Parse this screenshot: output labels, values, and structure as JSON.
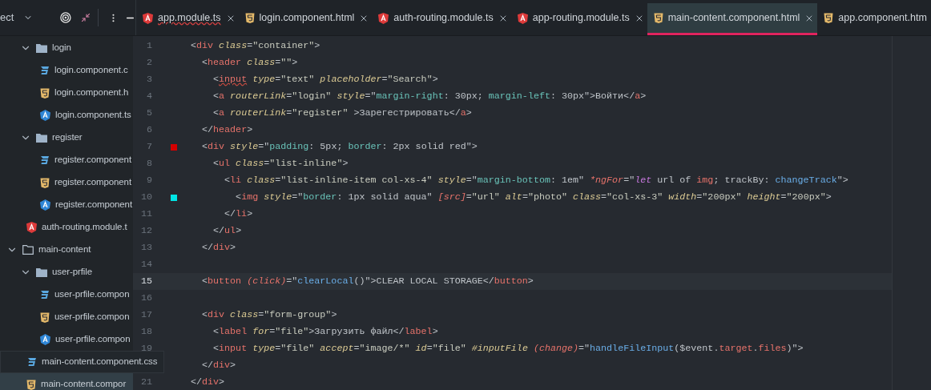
{
  "project_panel": {
    "title": "ect"
  },
  "tree": [
    {
      "children": [
        {
          "label": "login",
          "kind": "folder",
          "expanded": true,
          "children": [
            {
              "label": "login.component.c",
              "kind": "css"
            },
            {
              "label": "login.component.h",
              "kind": "html"
            },
            {
              "label": "login.component.ts",
              "kind": "ts"
            }
          ]
        },
        {
          "label": "register",
          "kind": "folder",
          "expanded": true,
          "children": [
            {
              "label": "register.component",
              "kind": "css"
            },
            {
              "label": "register.component",
              "kind": "html"
            },
            {
              "label": "register.component",
              "kind": "ts"
            }
          ]
        },
        {
          "label": "auth-routing.module.t",
          "kind": "angular"
        }
      ]
    },
    {
      "label": "main-content",
      "kind": "folder-outline",
      "expanded": true,
      "children": [
        {
          "label": "user-prfile",
          "kind": "folder",
          "expanded": true,
          "children": [
            {
              "label": "user-prfile.compon",
              "kind": "css"
            },
            {
              "label": "user-prfile.compon",
              "kind": "html"
            },
            {
              "label": "user-prfile.compon",
              "kind": "ts"
            }
          ]
        },
        {
          "label": "main-content.component.css",
          "kind": "css",
          "hovered": true
        },
        {
          "label": "main-content.compor",
          "kind": "html",
          "selected": true
        }
      ]
    }
  ],
  "tabs": [
    {
      "label": "app.module.ts",
      "kind": "angular",
      "error": true,
      "selected": false,
      "closable": true
    },
    {
      "label": "login.component.html",
      "kind": "html",
      "error": false,
      "selected": false,
      "closable": true
    },
    {
      "label": "auth-routing.module.ts",
      "kind": "angular",
      "error": false,
      "selected": false,
      "closable": true
    },
    {
      "label": "app-routing.module.ts",
      "kind": "angular",
      "error": false,
      "selected": false,
      "closable": true
    },
    {
      "label": "main-content.component.html",
      "kind": "html",
      "error": false,
      "selected": true,
      "closable": true
    },
    {
      "label": "app.component.htm",
      "kind": "html",
      "error": false,
      "selected": false,
      "closable": false
    }
  ],
  "lines": [
    {
      "number": "1",
      "current": false,
      "tokens": [
        {
          "kind": "punct",
          "text": "<"
        },
        {
          "kind": "tag",
          "text": "div"
        },
        {
          "kind": "attr",
          "text": " class"
        },
        {
          "kind": "punct",
          "text": "="
        },
        {
          "kind": "str",
          "text": "\"container\""
        },
        {
          "kind": "punct",
          "text": ">"
        }
      ]
    },
    {
      "number": "2",
      "current": false,
      "tokens": [
        {
          "kind": "punct",
          "text": "  <"
        },
        {
          "kind": "tag",
          "text": "header"
        },
        {
          "kind": "attr",
          "text": " class"
        },
        {
          "kind": "punct",
          "text": "="
        },
        {
          "kind": "str",
          "text": "\"\""
        },
        {
          "kind": "punct",
          "text": ">"
        }
      ]
    },
    {
      "number": "3",
      "current": false,
      "tokens": [
        {
          "kind": "punct",
          "text": "    <"
        },
        {
          "kind": "tagerr",
          "text": "input"
        },
        {
          "kind": "attr",
          "text": " type"
        },
        {
          "kind": "punct",
          "text": "="
        },
        {
          "kind": "str",
          "text": "\"text\""
        },
        {
          "kind": "attr",
          "text": " placeholder"
        },
        {
          "kind": "punct",
          "text": "="
        },
        {
          "kind": "str",
          "text": "\"Search\""
        },
        {
          "kind": "punct",
          "text": ">"
        }
      ]
    },
    {
      "number": "4",
      "current": false,
      "tokens": [
        {
          "kind": "punct",
          "text": "    <"
        },
        {
          "kind": "tag",
          "text": "a"
        },
        {
          "kind": "attr",
          "text": " routerLink"
        },
        {
          "kind": "punct",
          "text": "="
        },
        {
          "kind": "str",
          "text": "\"login\""
        },
        {
          "kind": "attr",
          "text": " style"
        },
        {
          "kind": "punct",
          "text": "=\""
        },
        {
          "kind": "prop",
          "text": "margin-right"
        },
        {
          "kind": "punct",
          "text": ": 30px; "
        },
        {
          "kind": "prop",
          "text": "margin-left"
        },
        {
          "kind": "punct",
          "text": ": 30px\">Войти</"
        },
        {
          "kind": "tag",
          "text": "a"
        },
        {
          "kind": "punct",
          "text": ">"
        }
      ]
    },
    {
      "number": "5",
      "current": false,
      "tokens": [
        {
          "kind": "punct",
          "text": "    <"
        },
        {
          "kind": "tag",
          "text": "a"
        },
        {
          "kind": "attr",
          "text": " routerLink"
        },
        {
          "kind": "punct",
          "text": "="
        },
        {
          "kind": "str",
          "text": "\"register\""
        },
        {
          "kind": "punct",
          "text": " >Зарегестрировать</"
        },
        {
          "kind": "tag",
          "text": "a"
        },
        {
          "kind": "punct",
          "text": ">"
        }
      ]
    },
    {
      "number": "6",
      "current": false,
      "tokens": [
        {
          "kind": "punct",
          "text": "  </"
        },
        {
          "kind": "tag",
          "text": "header"
        },
        {
          "kind": "punct",
          "text": ">"
        }
      ]
    },
    {
      "number": "7",
      "current": false,
      "color": "#d40000",
      "tokens": [
        {
          "kind": "punct",
          "text": "  <"
        },
        {
          "kind": "tag",
          "text": "div"
        },
        {
          "kind": "attr",
          "text": " style"
        },
        {
          "kind": "punct",
          "text": "=\""
        },
        {
          "kind": "prop",
          "text": "padding"
        },
        {
          "kind": "punct",
          "text": ": 5px; "
        },
        {
          "kind": "prop",
          "text": "border"
        },
        {
          "kind": "punct",
          "text": ": 2px solid red\">"
        }
      ]
    },
    {
      "number": "8",
      "current": false,
      "tokens": [
        {
          "kind": "punct",
          "text": "    <"
        },
        {
          "kind": "tag",
          "text": "ul"
        },
        {
          "kind": "attr",
          "text": " class"
        },
        {
          "kind": "punct",
          "text": "="
        },
        {
          "kind": "str",
          "text": "\"list-inline\""
        },
        {
          "kind": "punct",
          "text": ">"
        }
      ]
    },
    {
      "number": "9",
      "current": false,
      "tokens": [
        {
          "kind": "punct",
          "text": "      <"
        },
        {
          "kind": "tag",
          "text": "li"
        },
        {
          "kind": "attr",
          "text": " class"
        },
        {
          "kind": "punct",
          "text": "="
        },
        {
          "kind": "str",
          "text": "\"list-inline-item col-xs-4\""
        },
        {
          "kind": "attr",
          "text": " style"
        },
        {
          "kind": "punct",
          "text": "=\""
        },
        {
          "kind": "prop",
          "text": "margin-bottom"
        },
        {
          "kind": "punct",
          "text": ": 1em\""
        },
        {
          "kind": "event",
          "text": " *ngFor"
        },
        {
          "kind": "punct",
          "text": "=\""
        },
        {
          "kind": "kw",
          "text": "let"
        },
        {
          "kind": "punct",
          "text": " url of "
        },
        {
          "kind": "var",
          "text": "img"
        },
        {
          "kind": "punct",
          "text": "; trackBy: "
        },
        {
          "kind": "call",
          "text": "changeTrack"
        },
        {
          "kind": "punct",
          "text": "\">"
        }
      ]
    },
    {
      "number": "10",
      "current": false,
      "color": "#00e5e5",
      "tokens": [
        {
          "kind": "punct",
          "text": "        <"
        },
        {
          "kind": "tag",
          "text": "img"
        },
        {
          "kind": "attr",
          "text": " style"
        },
        {
          "kind": "punct",
          "text": "=\""
        },
        {
          "kind": "prop",
          "text": "border"
        },
        {
          "kind": "punct",
          "text": ": 1px solid aqua\""
        },
        {
          "kind": "event",
          "text": " [src]"
        },
        {
          "kind": "punct",
          "text": "="
        },
        {
          "kind": "str",
          "text": "\"url\""
        },
        {
          "kind": "attr",
          "text": " alt"
        },
        {
          "kind": "punct",
          "text": "="
        },
        {
          "kind": "str",
          "text": "\"photo\""
        },
        {
          "kind": "attr",
          "text": " class"
        },
        {
          "kind": "punct",
          "text": "="
        },
        {
          "kind": "str",
          "text": "\"col-xs-3\""
        },
        {
          "kind": "attr",
          "text": " width"
        },
        {
          "kind": "punct",
          "text": "="
        },
        {
          "kind": "str",
          "text": "\"200px\""
        },
        {
          "kind": "attr",
          "text": " height"
        },
        {
          "kind": "punct",
          "text": "="
        },
        {
          "kind": "str",
          "text": "\"200px\""
        },
        {
          "kind": "punct",
          "text": ">"
        }
      ]
    },
    {
      "number": "11",
      "current": false,
      "tokens": [
        {
          "kind": "punct",
          "text": "      </"
        },
        {
          "kind": "tag",
          "text": "li"
        },
        {
          "kind": "punct",
          "text": ">"
        }
      ]
    },
    {
      "number": "12",
      "current": false,
      "tokens": [
        {
          "kind": "punct",
          "text": "    </"
        },
        {
          "kind": "tag",
          "text": "ul"
        },
        {
          "kind": "punct",
          "text": ">"
        }
      ]
    },
    {
      "number": "13",
      "current": false,
      "tokens": [
        {
          "kind": "punct",
          "text": "  </"
        },
        {
          "kind": "tag",
          "text": "div"
        },
        {
          "kind": "punct",
          "text": ">"
        }
      ]
    },
    {
      "number": "14",
      "current": false
    },
    {
      "number": "15",
      "current": true,
      "tokens": [
        {
          "kind": "punct",
          "text": "  <"
        },
        {
          "kind": "tag",
          "text": "button"
        },
        {
          "kind": "event",
          "text": " (click)"
        },
        {
          "kind": "punct",
          "text": "=\""
        },
        {
          "kind": "call",
          "text": "clearLocal"
        },
        {
          "kind": "punct",
          "text": "()\">CLEAR LOCAL STORAGE</"
        },
        {
          "kind": "tag",
          "text": "button"
        },
        {
          "kind": "punct",
          "text": ">"
        }
      ]
    },
    {
      "number": "16",
      "current": false
    },
    {
      "number": "17",
      "current": false,
      "tokens": [
        {
          "kind": "punct",
          "text": "  <"
        },
        {
          "kind": "tag",
          "text": "div"
        },
        {
          "kind": "attr",
          "text": " class"
        },
        {
          "kind": "punct",
          "text": "="
        },
        {
          "kind": "str",
          "text": "\"form-group\""
        },
        {
          "kind": "punct",
          "text": ">"
        }
      ]
    },
    {
      "number": "18",
      "current": false,
      "tokens": [
        {
          "kind": "punct",
          "text": "    <"
        },
        {
          "kind": "tag",
          "text": "label"
        },
        {
          "kind": "attr",
          "text": " for"
        },
        {
          "kind": "punct",
          "text": "="
        },
        {
          "kind": "str",
          "text": "\"file\""
        },
        {
          "kind": "punct",
          "text": ">Загрузить файл</"
        },
        {
          "kind": "tag",
          "text": "label"
        },
        {
          "kind": "punct",
          "text": ">"
        }
      ]
    },
    {
      "number": "19",
      "current": false,
      "tokens": [
        {
          "kind": "punct",
          "text": "    <"
        },
        {
          "kind": "tag",
          "text": "input"
        },
        {
          "kind": "attr",
          "text": " type"
        },
        {
          "kind": "punct",
          "text": "="
        },
        {
          "kind": "str",
          "text": "\"file\""
        },
        {
          "kind": "attr",
          "text": " accept"
        },
        {
          "kind": "punct",
          "text": "="
        },
        {
          "kind": "str",
          "text": "\"image/*\""
        },
        {
          "kind": "attr",
          "text": " id"
        },
        {
          "kind": "punct",
          "text": "="
        },
        {
          "kind": "str",
          "text": "\"file\""
        },
        {
          "kind": "attr",
          "text": " #inputFile"
        },
        {
          "kind": "event",
          "text": " (change)"
        },
        {
          "kind": "punct",
          "text": "=\""
        },
        {
          "kind": "call",
          "text": "handleFileInput"
        },
        {
          "kind": "punct",
          "text": "($event."
        },
        {
          "kind": "var",
          "text": "target"
        },
        {
          "kind": "punct",
          "text": "."
        },
        {
          "kind": "var",
          "text": "files"
        },
        {
          "kind": "punct",
          "text": ")\">"
        }
      ]
    },
    {
      "tokens": [
        {
          "kind": "punct",
          "text": "  </"
        },
        {
          "kind": "tag",
          "text": "div"
        },
        {
          "kind": "punct",
          "text": ">"
        }
      ]
    },
    {
      "number": "21",
      "current": false,
      "tokens": [
        {
          "kind": "punct",
          "text": "</"
        },
        {
          "kind": "tag",
          "text": "div"
        },
        {
          "kind": "punct",
          "text": ">"
        }
      ]
    }
  ]
}
